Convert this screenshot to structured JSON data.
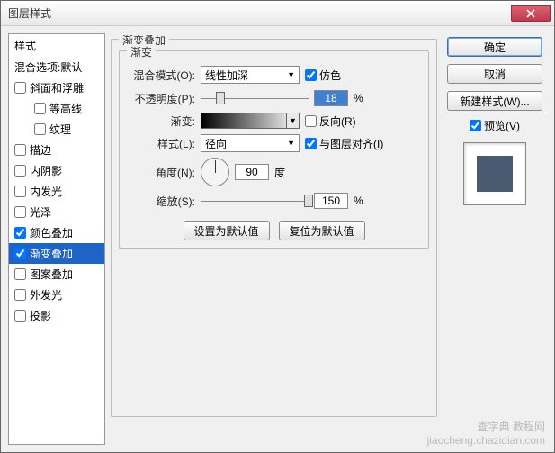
{
  "window": {
    "title": "图层样式"
  },
  "left": {
    "header": "样式",
    "blend": "混合选项:默认",
    "items": [
      {
        "label": "斜面和浮雕",
        "checked": false
      },
      {
        "label": "等高线",
        "checked": false,
        "indent": true
      },
      {
        "label": "纹理",
        "checked": false,
        "indent": true
      },
      {
        "label": "描边",
        "checked": false
      },
      {
        "label": "内阴影",
        "checked": false
      },
      {
        "label": "内发光",
        "checked": false
      },
      {
        "label": "光泽",
        "checked": false
      },
      {
        "label": "颜色叠加",
        "checked": true
      },
      {
        "label": "渐变叠加",
        "checked": true,
        "selected": true
      },
      {
        "label": "图案叠加",
        "checked": false
      },
      {
        "label": "外发光",
        "checked": false
      },
      {
        "label": "投影",
        "checked": false
      }
    ]
  },
  "center": {
    "group_title": "渐变叠加",
    "inner_title": "渐变",
    "blend_label": "混合模式(O):",
    "blend_value": "线性加深",
    "dither_label": "仿色",
    "opacity_label": "不透明度(P):",
    "opacity_value": "18",
    "pct": "%",
    "gradient_label": "渐变:",
    "reverse_label": "反向(R)",
    "style_label": "样式(L):",
    "style_value": "径向",
    "align_label": "与图层对齐(I)",
    "angle_label": "角度(N):",
    "angle_value": "90",
    "angle_unit": "度",
    "scale_label": "缩放(S):",
    "scale_value": "150",
    "make_default": "设置为默认值",
    "reset_default": "复位为默认值"
  },
  "right": {
    "ok": "确定",
    "cancel": "取消",
    "new_style": "新建样式(W)...",
    "preview_label": "预览(V)"
  },
  "watermark": {
    "l1": "查字典 教程网",
    "l2": "jiaocheng.chazidian.com"
  },
  "chart_data": null
}
